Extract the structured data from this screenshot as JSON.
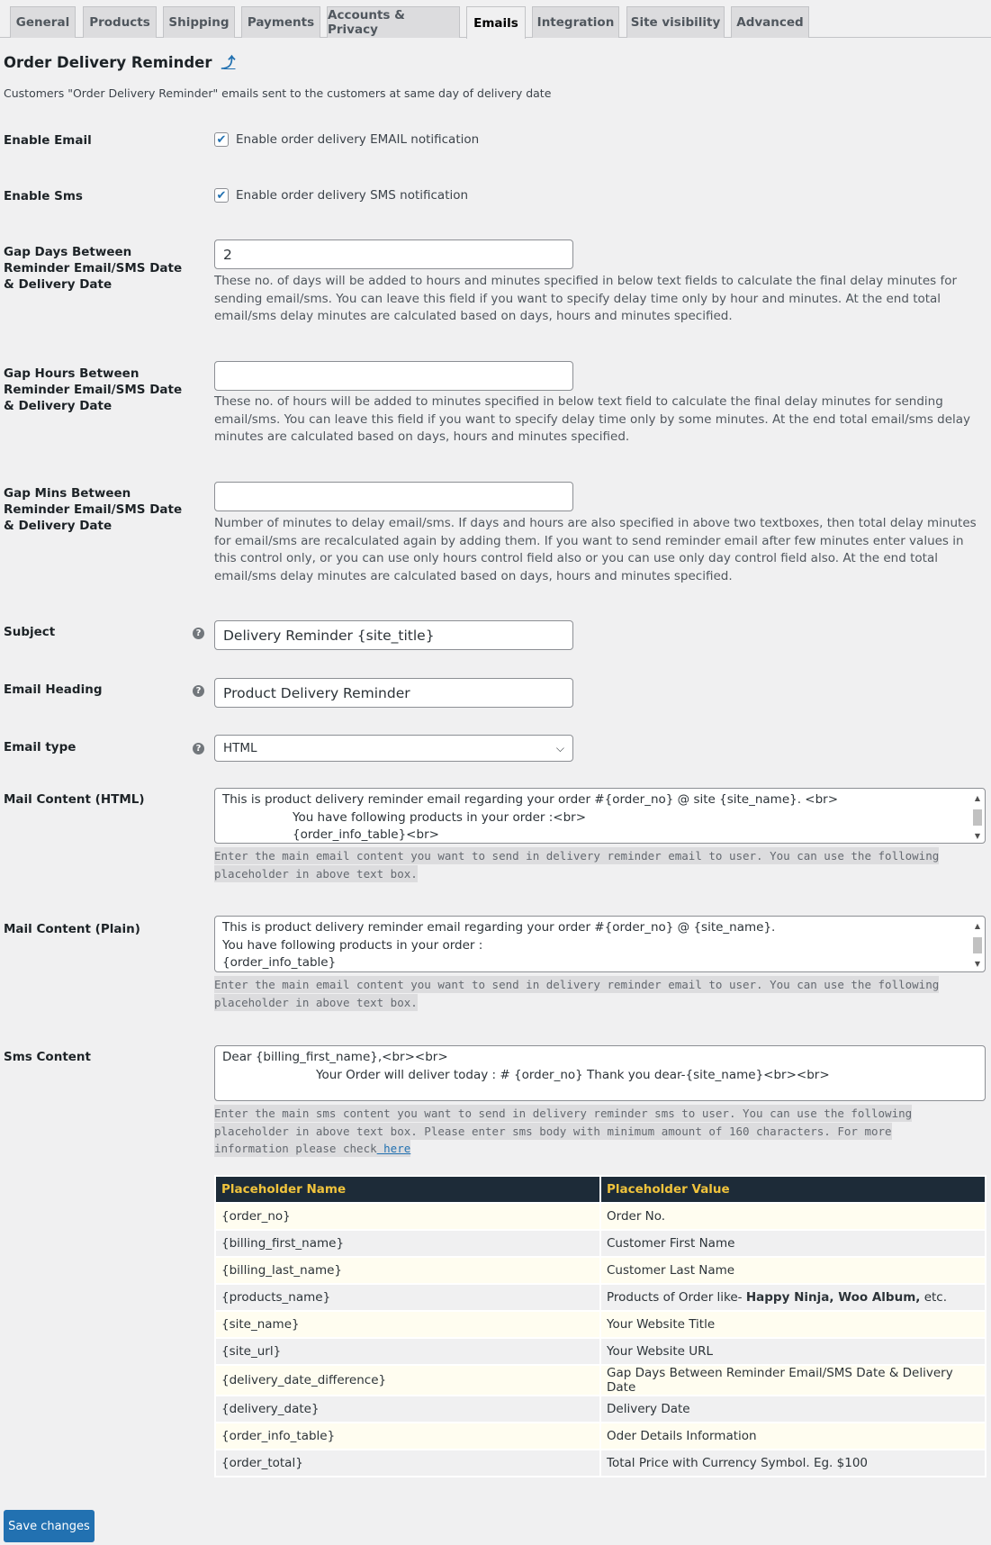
{
  "tabs": [
    "General",
    "Products",
    "Shipping",
    "Payments",
    "Accounts & Privacy",
    "Emails",
    "Integration",
    "Site visibility",
    "Advanced"
  ],
  "active_tab": "Emails",
  "title": "Order Delivery Reminder",
  "title_link_icon": "up-arrow-icon",
  "description": "Customers \"Order Delivery Reminder\" emails sent to the customers at same day of delivery date",
  "enable_email": {
    "label": "Enable Email",
    "checkbox_label": "Enable order delivery EMAIL notification",
    "checked": true
  },
  "enable_sms": {
    "label": "Enable Sms",
    "checkbox_label": "Enable order delivery SMS notification",
    "checked": true
  },
  "gap_days": {
    "label": "Gap Days Between Reminder Email/SMS Date & Delivery Date",
    "value": "2",
    "desc": "These no. of days will be added to hours and minutes specified in below text fields to calculate the final delay minutes for sending email/sms. You can leave this field if you want to specify delay time only by hour and minutes. At the end total email/sms delay minutes are calculated based on days, hours and minutes specified."
  },
  "gap_hours": {
    "label": "Gap Hours Between Reminder Email/SMS Date & Delivery Date",
    "value": "",
    "desc": "These no. of hours will be added to minutes specified in below text field to calculate the final delay minutes for sending email/sms. You can leave this field if you want to specify delay time only by some minutes. At the end total email/sms delay minutes are calculated based on days, hours and minutes specified."
  },
  "gap_mins": {
    "label": "Gap Mins Between Reminder Email/SMS Date & Delivery Date",
    "value": "",
    "desc": "Number of minutes to delay email/sms. If days and hours are also specified in above two textboxes, then total delay minutes for email/sms are recalculated again by adding them. If you want to send reminder email after few minutes enter values in this control only, or you can use only hours control field also or you can use only day control field also. At the end total email/sms delay minutes are calculated based on days, hours and minutes specified."
  },
  "subject": {
    "label": "Subject",
    "value": "Delivery Reminder {site_title}"
  },
  "email_heading": {
    "label": "Email Heading",
    "value": "Product Delivery Reminder"
  },
  "email_type": {
    "label": "Email type",
    "value": "HTML"
  },
  "mail_html": {
    "label": "Mail Content (HTML)",
    "lines": [
      "This is product delivery reminder email regarding your order #{order_no} @ site {site_name}. <br>",
      "You have following products in your order :<br>",
      "{order_info_table}<br>"
    ],
    "hint1": "Enter the main email content you want to send in delivery reminder email to user. You can use the following",
    "hint2": "placeholder in above text box."
  },
  "mail_plain": {
    "label": "Mail Content (Plain)",
    "lines": [
      "This is product delivery reminder email regarding your order #{order_no} @  {site_name}.",
      "You have following products in your order :",
      "{order_info_table}"
    ],
    "hint1": "Enter the main email content you want to send in delivery reminder email to user. You can use the following",
    "hint2": "placeholder in above text box."
  },
  "sms": {
    "label": "Sms Content",
    "lines": [
      "Dear {billing_first_name},<br><br>",
      "Your Order will deliver today : # {order_no} Thank you dear-{site_name}<br><br>"
    ],
    "hint1": "Enter the main sms content you want to send in delivery reminder sms to user. You can use the following",
    "hint2": "placeholder in above text box. Please enter sms body with minimum amount of 160 characters. For more",
    "hint3": "information please check",
    "link": " here"
  },
  "table": {
    "headers": [
      "Placeholder Name",
      "Placeholder Value"
    ],
    "rows": [
      [
        "{order_no}",
        "Order No."
      ],
      [
        "{billing_first_name}",
        "Customer First Name"
      ],
      [
        "{billing_last_name}",
        "Customer Last Name"
      ],
      [
        "{products_name}",
        "Products of Order like- ",
        "Happy Ninja, Woo Album,",
        " etc."
      ],
      [
        "{site_name}",
        "Your Website Title"
      ],
      [
        "{site_url}",
        "Your Website URL"
      ],
      [
        "{delivery_date_difference}",
        "Gap Days Between Reminder Email/SMS Date & Delivery Date"
      ],
      [
        "{delivery_date}",
        "Delivery Date"
      ],
      [
        "{order_info_table}",
        "Oder Details Information"
      ],
      [
        "{order_total}",
        "Total Price with Currency Symbol. Eg. $100"
      ]
    ]
  },
  "save_label": "Save changes",
  "colors": {
    "accent": "#2271b1",
    "table_header": "#1d2b38",
    "table_header_text": "#f0c33c"
  }
}
